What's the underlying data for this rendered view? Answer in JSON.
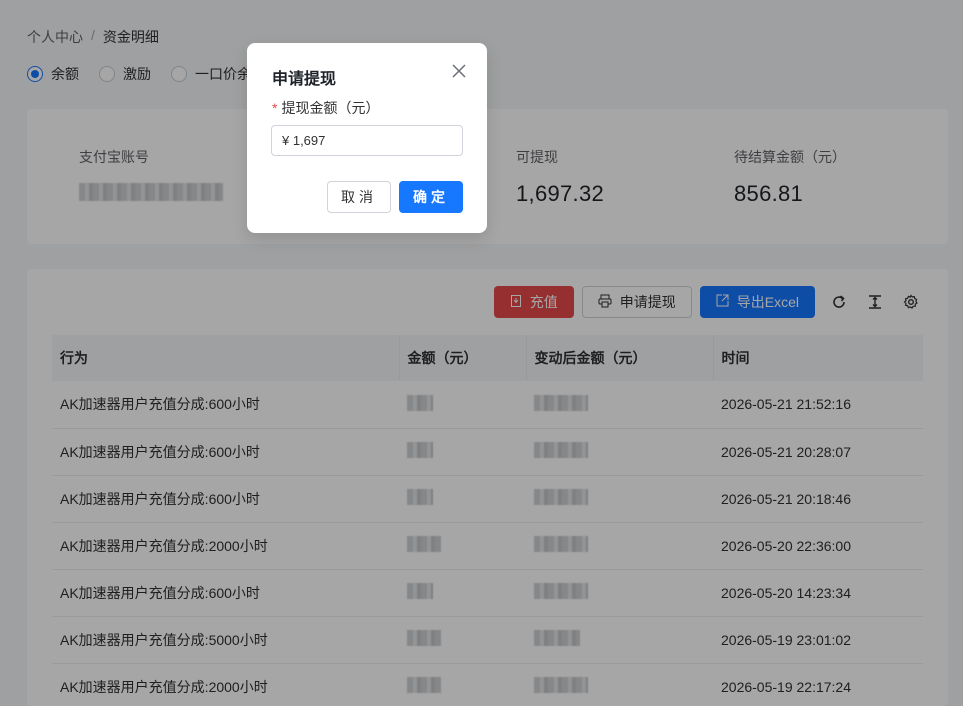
{
  "breadcrumb": {
    "parent": "个人中心",
    "separator": "/",
    "current": "资金明细"
  },
  "radios": [
    {
      "label": "余额",
      "checked": true
    },
    {
      "label": "激励",
      "checked": false
    },
    {
      "label": "一口价余额",
      "checked": false
    }
  ],
  "stats": {
    "alipay_label": "支付宝账号",
    "withdrawable_label": "可提现",
    "withdrawable_value": "1,697.32",
    "pending_label": "待结算金额（元）",
    "pending_value": "856.81"
  },
  "toolbar": {
    "recharge": "充值",
    "withdraw": "申请提现",
    "export": "导出Excel"
  },
  "table": {
    "headers": [
      "行为",
      "金额（元）",
      "变动后金额（元）",
      "时间"
    ],
    "rows": [
      {
        "action": "AK加速器用户充值分成:600小时",
        "time": "2026-05-21 21:52:16"
      },
      {
        "action": "AK加速器用户充值分成:600小时",
        "time": "2026-05-21 20:28:07"
      },
      {
        "action": "AK加速器用户充值分成:600小时",
        "time": "2026-05-21 20:18:46"
      },
      {
        "action": "AK加速器用户充值分成:2000小时",
        "time": "2026-05-20 22:36:00"
      },
      {
        "action": "AK加速器用户充值分成:600小时",
        "time": "2026-05-20 14:23:34"
      },
      {
        "action": "AK加速器用户充值分成:5000小时",
        "time": "2026-05-19 23:01:02"
      },
      {
        "action": "AK加速器用户充值分成:2000小时",
        "time": "2026-05-19 22:17:24"
      }
    ]
  },
  "modal": {
    "title": "申请提现",
    "required_mark": "*",
    "field_label": "提现金额（元）",
    "input_value": "¥ 1,697",
    "cancel": "取消",
    "confirm": "确定"
  },
  "colors": {
    "primary": "#1677ff",
    "danger": "#e64a4a"
  }
}
